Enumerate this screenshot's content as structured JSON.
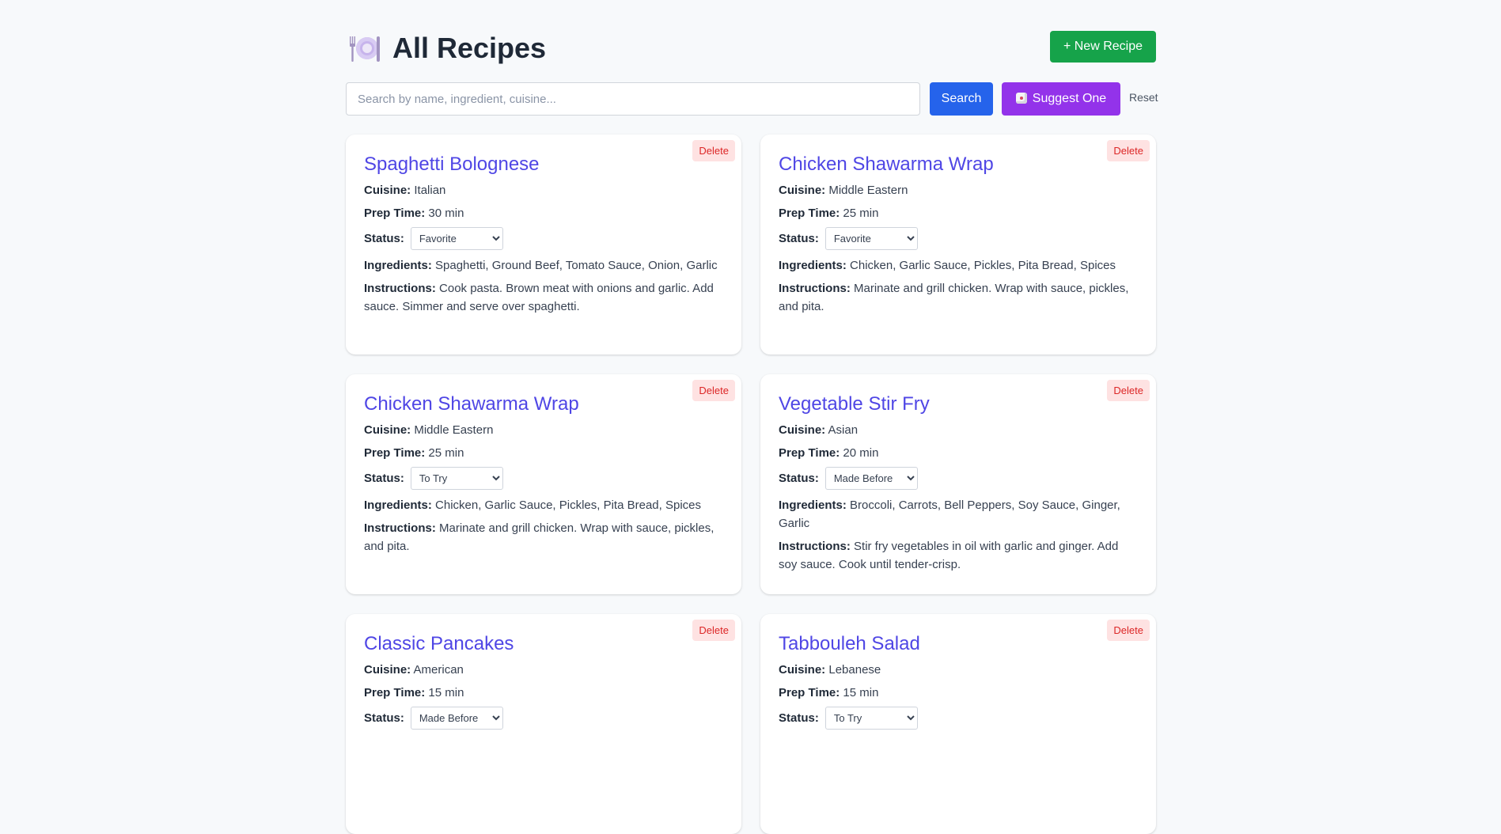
{
  "header": {
    "title": "All Recipes",
    "icon": "plate-with-cutlery-icon",
    "new_recipe": "+ New Recipe"
  },
  "search": {
    "placeholder": "Search by name, ingredient, cuisine...",
    "value": "",
    "search_label": "Search",
    "suggest_label": "Suggest One",
    "reset_label": "Reset"
  },
  "labels": {
    "delete": "Delete",
    "cuisine": "Cuisine:",
    "prep_time": "Prep Time:",
    "status": "Status:",
    "ingredients": "Ingredients:",
    "instructions": "Instructions:"
  },
  "recipes": [
    {
      "name": "Spaghetti Bolognese",
      "cuisine": "Italian",
      "prep_time": "30 min",
      "status": "Favorite",
      "ingredients": "Spaghetti, Ground Beef, Tomato Sauce, Onion, Garlic",
      "instructions": "Cook pasta. Brown meat with onions and garlic. Add sauce. Simmer and serve over spaghetti."
    },
    {
      "name": "Chicken Shawarma Wrap",
      "cuisine": "Middle Eastern",
      "prep_time": "25 min",
      "status": "Favorite",
      "ingredients": "Chicken, Garlic Sauce, Pickles, Pita Bread, Spices",
      "instructions": "Marinate and grill chicken. Wrap with sauce, pickles, and pita."
    },
    {
      "name": "Chicken Shawarma Wrap",
      "cuisine": "Middle Eastern",
      "prep_time": "25 min",
      "status": "To Try",
      "ingredients": "Chicken, Garlic Sauce, Pickles, Pita Bread, Spices",
      "instructions": "Marinate and grill chicken. Wrap with sauce, pickles, and pita."
    },
    {
      "name": "Vegetable Stir Fry",
      "cuisine": "Asian",
      "prep_time": "20 min",
      "status": "Made Before",
      "ingredients": "Broccoli, Carrots, Bell Peppers, Soy Sauce, Ginger, Garlic",
      "instructions": "Stir fry vegetables in oil with garlic and ginger. Add soy sauce. Cook until tender-crisp."
    },
    {
      "name": "Classic Pancakes",
      "cuisine": "American",
      "prep_time": "15 min",
      "status": "Made Before",
      "ingredients": "",
      "instructions": ""
    },
    {
      "name": "Tabbouleh Salad",
      "cuisine": "Lebanese",
      "prep_time": "15 min",
      "status": "To Try",
      "ingredients": "",
      "instructions": ""
    }
  ],
  "status_options": [
    "Favorite",
    "To Try",
    "Made Before"
  ],
  "colors": {
    "background": "#f7f9fb",
    "title": "#1f2937",
    "recipe_title": "#4f46e5",
    "new_recipe_button": "#16a34a",
    "search_button": "#2563eb",
    "suggest_button": "#9333ea",
    "delete_button_bg": "#fee2e2",
    "delete_button_text": "#dc2626"
  }
}
